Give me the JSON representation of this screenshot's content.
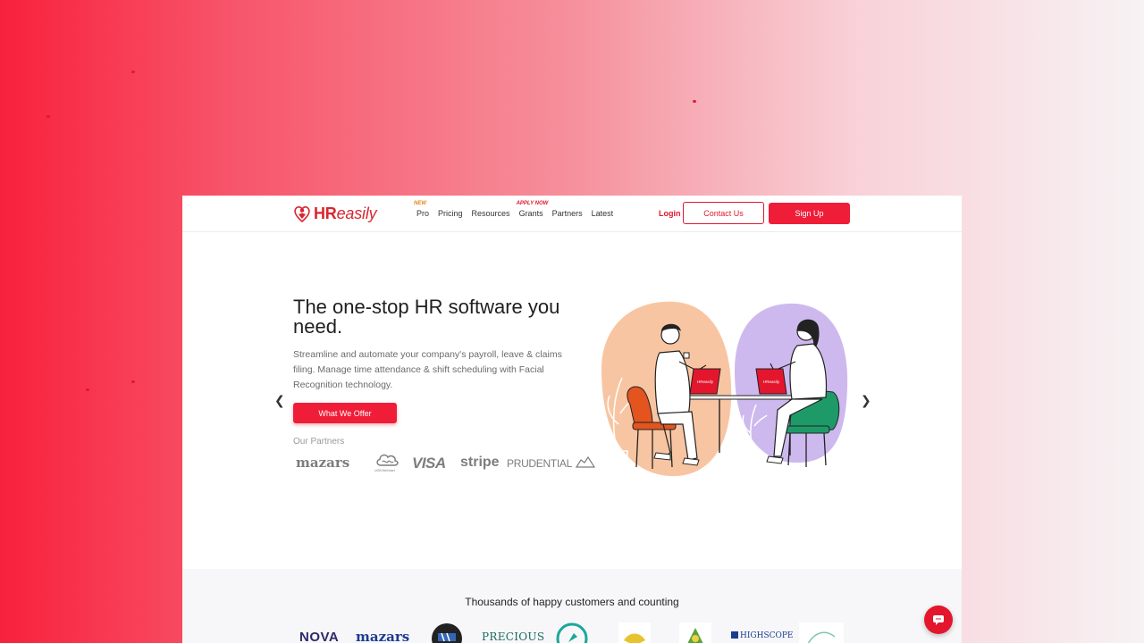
{
  "brand": {
    "logo_bold": "HR",
    "logo_italic": "easily"
  },
  "nav": {
    "links": [
      {
        "label": "Pro",
        "tag": "NEW"
      },
      {
        "label": "Pricing",
        "tag": ""
      },
      {
        "label": "Resources",
        "tag": ""
      },
      {
        "label": "Grants",
        "tag": "APPLY NOW"
      },
      {
        "label": "Partners",
        "tag": ""
      },
      {
        "label": "Latest",
        "tag": ""
      }
    ],
    "login": "Login",
    "contact": "Contact Us",
    "signup": "Sign Up"
  },
  "hero": {
    "title": "The one-stop HR software you need.",
    "subtitle": "Streamline and automate your company's payroll, leave & claims filing. Manage time attendance & shift scheduling with Facial Recognition technology.",
    "cta": "What We Offer",
    "partners_label": "Our Partners",
    "partners": [
      "mazars",
      "UOB BizSmart",
      "VISA",
      "stripe",
      "PRUDENTIAL"
    ],
    "screen_logo": "HReasily"
  },
  "customers": {
    "title": "Thousands of happy customers and counting",
    "logos": [
      "NOVA",
      "mazars",
      "PRECIOUS",
      "HIGHSCOPE"
    ]
  },
  "colors": {
    "brand_red": "#e3162e",
    "button_red": "#ef1d38",
    "new_tag": "#e8871a"
  },
  "icons": [
    "chevron-left-icon",
    "chevron-right-icon",
    "chat-icon"
  ]
}
